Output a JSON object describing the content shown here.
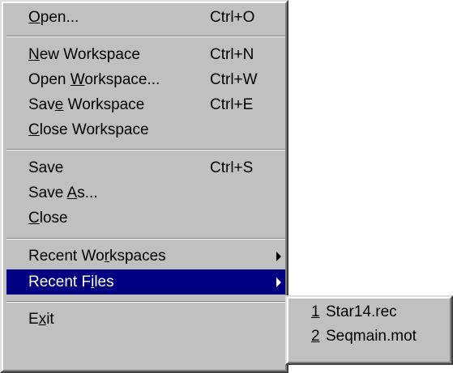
{
  "file_menu": {
    "open": {
      "label": "Open...",
      "shortcut": "Ctrl+O"
    },
    "new_workspace": {
      "label": "New Workspace",
      "shortcut": "Ctrl+N"
    },
    "open_workspace": {
      "label": "Open Workspace...",
      "shortcut": "Ctrl+W"
    },
    "save_workspace": {
      "label": "Save Workspace",
      "shortcut": "Ctrl+E"
    },
    "close_workspace": {
      "label": "Close Workspace"
    },
    "save": {
      "label": "Save",
      "shortcut": "Ctrl+S"
    },
    "save_as": {
      "label": "Save As..."
    },
    "close": {
      "label": "Close"
    },
    "recent_workspaces": {
      "label": "Recent Workspaces",
      "icon": "submenu-arrow-icon"
    },
    "recent_files": {
      "label": "Recent Files",
      "icon": "submenu-arrow-icon",
      "highlighted": true
    },
    "exit": {
      "label": "Exit"
    }
  },
  "recent_files_submenu": {
    "items": [
      {
        "number": "1",
        "name": "Star14.rec"
      },
      {
        "number": "2",
        "name": "Seqmain.mot"
      }
    ]
  },
  "colors": {
    "menu_background": "#c0c0c0",
    "highlight_background": "#000080",
    "highlight_text": "#ffffff",
    "text": "#000000"
  }
}
